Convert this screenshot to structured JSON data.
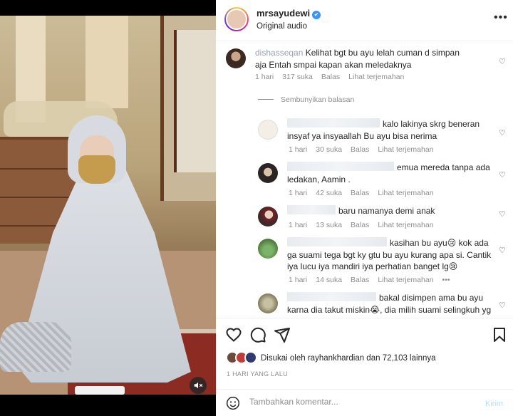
{
  "post": {
    "username": "mrsayudewi",
    "audio_label": "Original audio",
    "more_label": "•••",
    "verified_glyph": "✔"
  },
  "comments": [
    {
      "author_partial": "dishasseqan",
      "text": "Kelihat bgt bu ayu lelah cuman d simpan aja Entah smpai kapan akan meledaknya",
      "time": "1 hari",
      "likes": "317 suka",
      "reply": "Balas",
      "translate": "Lihat terjemahan"
    },
    {
      "text": "kalo lakinya skrg beneran insyaf ya insyaallah Bu ayu bisa nerima",
      "time": "1 hari",
      "likes": "30 suka",
      "reply": "Balas",
      "translate": "Lihat terjemahan"
    },
    {
      "text": "emua mereda tanpa ada ledakan, Aamin .",
      "time": "1 hari",
      "likes": "42 suka",
      "reply": "Balas",
      "translate": "Lihat terjemahan"
    },
    {
      "text": "baru namanya demi anak",
      "time": "1 hari",
      "likes": "13 suka",
      "reply": "Balas",
      "translate": "Lihat terjemahan"
    },
    {
      "text": "kasihan bu ayu😢 kok ada ga suami tega bgt ky gtu bu ayu kurang apa si. Cantik iya lucu iya mandiri iya perhatian banget lg😢",
      "time": "1 hari",
      "likes": "14 suka",
      "reply": "Balas",
      "translate": "Lihat terjemahan",
      "more": "•••"
    },
    {
      "text": "bakal disimpen ama bu ayu karna dia takut miskin😭, dia milih suami selingkuh yg"
    }
  ],
  "hide_replies": "Sembunyikan balasan",
  "likes_summary": "Disukai oleh rayhankhardian dan 72,103 lainnya",
  "date": "1 HARI YANG LALU",
  "comment_box": {
    "placeholder": "Tambahkan komentar...",
    "post_label": "Kirim"
  },
  "icons": {
    "heart": "heart-icon",
    "comment": "comment-icon",
    "share": "share-icon",
    "save": "bookmark-icon",
    "emoji": "smiley-icon",
    "mute": "speaker-muted-icon"
  },
  "colors": {
    "verified": "#3897f0",
    "secondary_text": "#8e8e8e",
    "post_disabled": "#b2dffc"
  }
}
